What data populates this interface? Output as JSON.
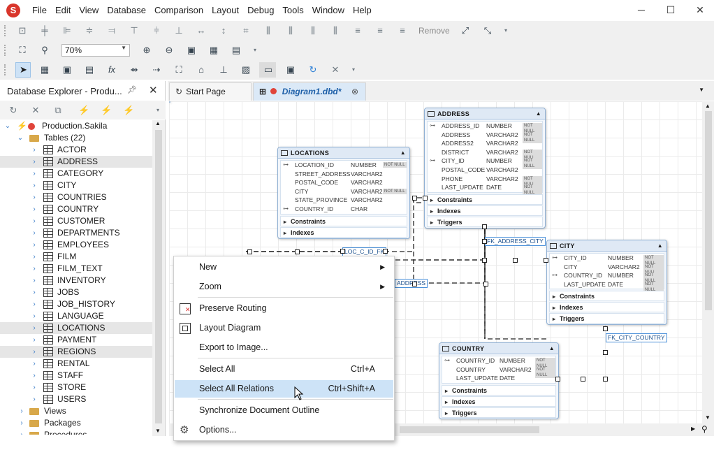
{
  "menubar": [
    "File",
    "Edit",
    "View",
    "Database",
    "Comparison",
    "Layout",
    "Debug",
    "Tools",
    "Window",
    "Help"
  ],
  "app_logo": "S",
  "toolbar": {
    "remove_label": "Remove",
    "zoom_value": "70%"
  },
  "explorer": {
    "title": "Database Explorer - Produ...",
    "connection": "Production.Sakila",
    "tables_folder": "Tables (22)",
    "tables": [
      "ACTOR",
      "ADDRESS",
      "CATEGORY",
      "CITY",
      "COUNTRIES",
      "COUNTRY",
      "CUSTOMER",
      "DEPARTMENTS",
      "EMPLOYEES",
      "FILM",
      "FILM_TEXT",
      "INVENTORY",
      "JOBS",
      "JOB_HISTORY",
      "LANGUAGE",
      "LOCATIONS",
      "PAYMENT",
      "REGIONS",
      "RENTAL",
      "STAFF",
      "STORE",
      "USERS"
    ],
    "folders": [
      "Views",
      "Packages",
      "Procedures"
    ]
  },
  "tabs": [
    {
      "label": "Start Page"
    },
    {
      "label": "Diagram1.dbd*"
    }
  ],
  "diagram": {
    "entities": {
      "locations": {
        "title": "LOCATIONS",
        "columns": [
          {
            "name": "LOCATION_ID",
            "type": "NUMBER",
            "nn": "NOT NULL",
            "key": "⊶"
          },
          {
            "name": "STREET_ADDRESS",
            "type": "VARCHAR2",
            "nn": "",
            "key": ""
          },
          {
            "name": "POSTAL_CODE",
            "type": "VARCHAR2",
            "nn": "",
            "key": ""
          },
          {
            "name": "CITY",
            "type": "VARCHAR2",
            "nn": "NOT NULL",
            "key": ""
          },
          {
            "name": "STATE_PROVINCE",
            "type": "VARCHAR2",
            "nn": "",
            "key": ""
          },
          {
            "name": "COUNTRY_ID",
            "type": "CHAR",
            "nn": "",
            "key": "⊶"
          }
        ],
        "sections": [
          "Constraints",
          "Indexes"
        ]
      },
      "address": {
        "title": "ADDRESS",
        "columns": [
          {
            "name": "ADDRESS_ID",
            "type": "NUMBER",
            "nn": "NOT NULL",
            "key": "⊶"
          },
          {
            "name": "ADDRESS",
            "type": "VARCHAR2",
            "nn": "NOT NULL",
            "key": ""
          },
          {
            "name": "ADDRESS2",
            "type": "VARCHAR2",
            "nn": "",
            "key": ""
          },
          {
            "name": "DISTRICT",
            "type": "VARCHAR2",
            "nn": "NOT NULL",
            "key": ""
          },
          {
            "name": "CITY_ID",
            "type": "NUMBER",
            "nn": "NOT NULL",
            "key": "⊶"
          },
          {
            "name": "POSTAL_CODE",
            "type": "VARCHAR2",
            "nn": "",
            "key": ""
          },
          {
            "name": "PHONE",
            "type": "VARCHAR2",
            "nn": "NOT NULL",
            "key": ""
          },
          {
            "name": "LAST_UPDATE",
            "type": "DATE",
            "nn": "NOT NULL",
            "key": ""
          }
        ],
        "sections": [
          "Constraints",
          "Indexes",
          "Triggers"
        ]
      },
      "city": {
        "title": "CITY",
        "columns": [
          {
            "name": "CITY_ID",
            "type": "NUMBER",
            "nn": "NOT NULL",
            "key": "⊶"
          },
          {
            "name": "CITY",
            "type": "VARCHAR2",
            "nn": "NOT NULL",
            "key": ""
          },
          {
            "name": "COUNTRY_ID",
            "type": "NUMBER",
            "nn": "NOT NULL",
            "key": "⊶"
          },
          {
            "name": "LAST_UPDATE",
            "type": "DATE",
            "nn": "NOT NULL",
            "key": ""
          }
        ],
        "sections": [
          "Constraints",
          "Indexes",
          "Triggers"
        ]
      },
      "country": {
        "title": "COUNTRY",
        "columns": [
          {
            "name": "COUNTRY_ID",
            "type": "NUMBER",
            "nn": "NOT NULL",
            "key": "⊶"
          },
          {
            "name": "COUNTRY",
            "type": "VARCHAR2",
            "nn": "NOT NULL",
            "key": ""
          },
          {
            "name": "LAST_UPDATE",
            "type": "DATE",
            "nn": "",
            "key": ""
          }
        ],
        "sections": [
          "Constraints",
          "Indexes",
          "Triggers"
        ]
      }
    },
    "relations": {
      "address_city": "FK_ADDRESS_CITY",
      "city_country": "FK_CITY_COUNTRY",
      "loc_c_id": "LOC_C_ID_FK",
      "address_partial": "ADDRESS"
    },
    "partial_nn": "NOT NULL"
  },
  "context_menu": [
    {
      "label": "New",
      "shortcut": "",
      "submenu": true
    },
    {
      "label": "Zoom",
      "shortcut": "",
      "submenu": true
    },
    {
      "label": "Preserve Routing",
      "shortcut": "",
      "icon": "preserve-routing-icon"
    },
    {
      "label": "Layout Diagram",
      "shortcut": "",
      "icon": "layout-diagram-icon"
    },
    {
      "label": "Export to Image...",
      "shortcut": ""
    },
    {
      "label": "Select All",
      "shortcut": "Ctrl+A"
    },
    {
      "label": "Select All Relations",
      "shortcut": "Ctrl+Shift+A",
      "highlighted": true
    },
    {
      "label": "Synchronize Document Outline",
      "shortcut": ""
    },
    {
      "label": "Options...",
      "shortcut": "",
      "icon": "gear-icon"
    }
  ],
  "colors": {
    "accent": "#1d5fa8",
    "selection": "#cde3f7",
    "logo": "#d9362b"
  }
}
